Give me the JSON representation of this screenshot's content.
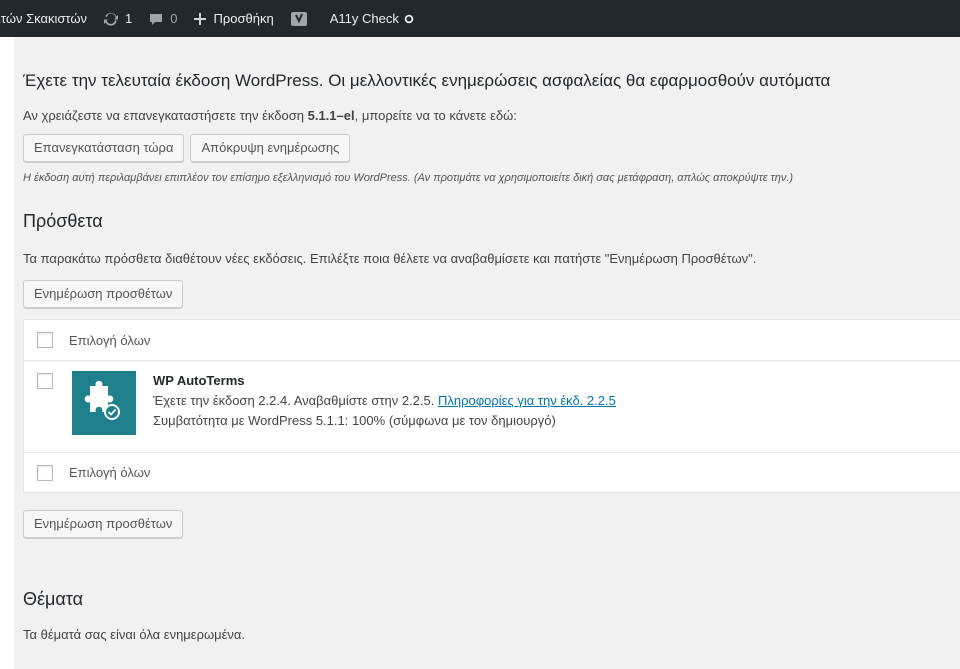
{
  "adminbar": {
    "site_name": "ιτών Σκακιστών",
    "updates_count": "1",
    "comments_count": "0",
    "new_label": "Προσθήκη",
    "a11y_label": "A11y Check"
  },
  "notice": {
    "title": "Έχετε την τελευταία έκδοση WordPress. Οι μελλοντικές ενημερώσεις ασφαλείας θα εφαρμοσθούν αυτόματα",
    "reinstall_text_prefix": "Αν χρειάζεστε να επανεγκαταστήσετε την έκδοση ",
    "reinstall_version": "5.1.1–el",
    "reinstall_text_suffix": ", μπορείτε να το κάνετε εδώ:",
    "reinstall_button": "Επανεγκατάσταση τώρα",
    "hide_button": "Απόκρυψη ενημέρωσης",
    "note": "Η έκδοση αυτή περιλαμβάνει επιπλέον τον επίσημο εξελληνισμό του WordPress. (Αν προτιμάτε να χρησιμοποιείτε δική σας μετάφραση, απλώς αποκρύψτε την.)"
  },
  "plugins": {
    "heading": "Πρόσθετα",
    "intro": "Τα παρακάτω πρόσθετα διαθέτουν νέες εκδόσεις. Επιλέξτε ποια θέλετε να αναβαθμίσετε και πατήστε \"Ενημέρωση Προσθέτων\".",
    "update_button": "Ενημέρωση προσθέτων",
    "select_all": "Επιλογή όλων",
    "items": [
      {
        "name": "WP AutoTerms",
        "version_text": "Έχετε την έκδοση 2.2.4. Αναβαθμίστε στην 2.2.5. ",
        "details_link": "Πληροφορίες για την έκδ. 2.2.5",
        "compat_text": "Συμβατότητα με WordPress 5.1.1: 100% (σύμφωνα με τον δημιουργό)",
        "icon": "puzzle-check-icon",
        "icon_color": "#1f7f8a"
      }
    ]
  },
  "themes": {
    "heading": "Θέματα",
    "text": "Τα θέματά σας είναι όλα ενημερωμένα."
  }
}
